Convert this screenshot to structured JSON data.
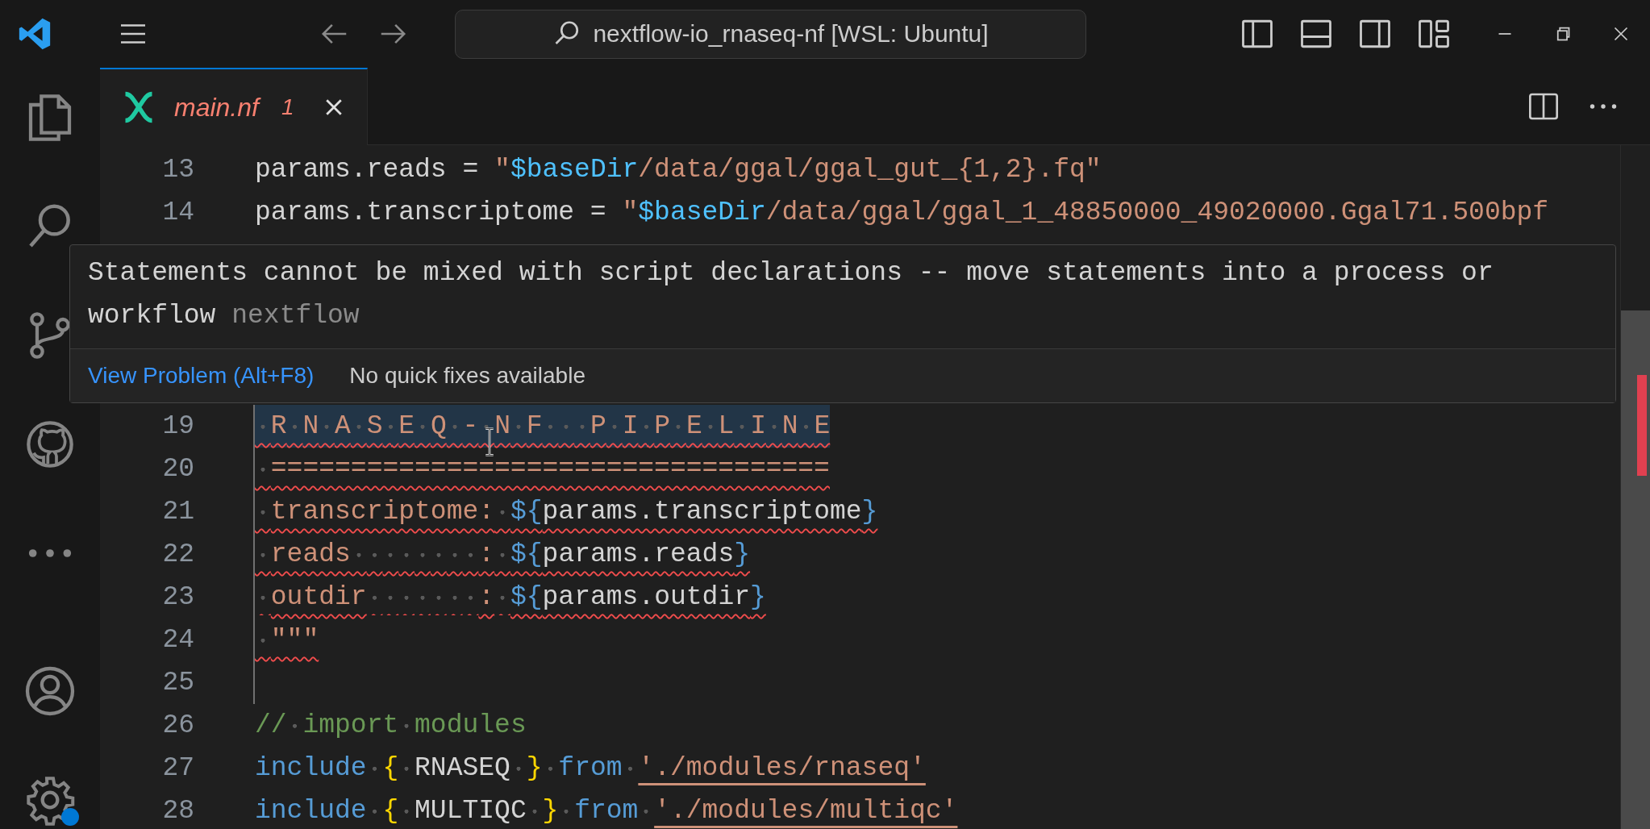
{
  "title_bar": {
    "search": "nextflow-io_rnaseq-nf [WSL: Ubuntu]"
  },
  "activity_bar": {
    "items": [
      {
        "kind": "files"
      },
      {
        "kind": "search"
      },
      {
        "kind": "source-control"
      },
      {
        "kind": "github"
      },
      {
        "kind": "more"
      },
      {
        "kind": "account"
      },
      {
        "kind": "settings",
        "badge": true
      }
    ]
  },
  "tabs": [
    {
      "label": "main.nf",
      "problems": "1",
      "selected": true,
      "has_errors": true
    }
  ],
  "editor": {
    "lines": [
      {
        "number": "13",
        "error": false,
        "selected": false,
        "whitespace": false,
        "guide": false,
        "tokens": [
          {
            "kind": "plain",
            "text": "params.reads = "
          },
          {
            "kind": "string",
            "text": "\""
          },
          {
            "kind": "var",
            "text": "$baseDir"
          },
          {
            "kind": "string",
            "text": "/data/ggal/ggal_gut_{1,2}.fq\""
          }
        ]
      },
      {
        "number": "14",
        "error": false,
        "selected": false,
        "whitespace": false,
        "guide": false,
        "tokens": [
          {
            "kind": "plain",
            "text": "params.transcriptome = "
          },
          {
            "kind": "string",
            "text": "\""
          },
          {
            "kind": "var",
            "text": "$baseDir"
          },
          {
            "kind": "string",
            "text": "/data/ggal/ggal_1_48850000_49020000.Ggal71.500bpf"
          }
        ]
      },
      {
        "number": "19",
        "error": true,
        "selected": true,
        "whitespace": true,
        "guide": true,
        "tokens": [
          {
            "kind": "string",
            "text": " R N A S E Q - N F   P I P E L I N E"
          }
        ]
      },
      {
        "number": "20",
        "error": true,
        "selected": false,
        "whitespace": true,
        "guide": true,
        "tokens": [
          {
            "kind": "string",
            "text": " ==================================="
          }
        ]
      },
      {
        "number": "21",
        "error": true,
        "selected": false,
        "whitespace": true,
        "guide": true,
        "tokens": [
          {
            "kind": "string",
            "text": " transcriptome: "
          },
          {
            "kind": "interp",
            "text": "${"
          },
          {
            "kind": "plain",
            "text": "params.transcriptome"
          },
          {
            "kind": "interp",
            "text": "}"
          }
        ]
      },
      {
        "number": "22",
        "error": true,
        "selected": false,
        "whitespace": true,
        "guide": true,
        "tokens": [
          {
            "kind": "string",
            "text": " reads        : "
          },
          {
            "kind": "interp",
            "text": "${"
          },
          {
            "kind": "plain",
            "text": "params.reads"
          },
          {
            "kind": "interp",
            "text": "}"
          }
        ]
      },
      {
        "number": "23",
        "error": true,
        "selected": false,
        "whitespace": true,
        "guide": true,
        "tokens": [
          {
            "kind": "string",
            "text": " outdir       : "
          },
          {
            "kind": "interp",
            "text": "${"
          },
          {
            "kind": "plain",
            "text": "params.outdir"
          },
          {
            "kind": "interp",
            "text": "}"
          }
        ]
      },
      {
        "number": "24",
        "error": true,
        "selected": false,
        "whitespace": true,
        "guide": true,
        "tokens": [
          {
            "kind": "string",
            "text": " \"\"\""
          }
        ]
      },
      {
        "number": "25",
        "error": false,
        "selected": false,
        "guide": true
      },
      {
        "number": "26",
        "error": false,
        "selected": false,
        "whitespace": true,
        "guide": false,
        "tokens": [
          {
            "kind": "comment",
            "text": "// import modules"
          }
        ]
      },
      {
        "number": "27",
        "error": false,
        "selected": false,
        "whitespace": true,
        "guide": false,
        "tokens": [
          {
            "kind": "keyword",
            "text": "include"
          },
          {
            "kind": "brace",
            "text": " {"
          },
          {
            "kind": "plain",
            "text": " RNASEQ "
          },
          {
            "kind": "brace",
            "text": "}"
          },
          {
            "kind": "keyword",
            "text": " from "
          },
          {
            "kind": "link",
            "text": "'./modules/rnaseq'"
          }
        ]
      },
      {
        "number": "28",
        "error": false,
        "selected": false,
        "whitespace": true,
        "guide": false,
        "tokens": [
          {
            "kind": "keyword",
            "text": "include"
          },
          {
            "kind": "brace",
            "text": " {"
          },
          {
            "kind": "plain",
            "text": " MULTIQC "
          },
          {
            "kind": "brace",
            "text": "}"
          },
          {
            "kind": "keyword",
            "text": " from "
          },
          {
            "kind": "link",
            "text": "'./modules/multiqc'"
          }
        ]
      }
    ]
  },
  "hover": {
    "message": "Statements cannot be mixed with script declarations -- move statements into a process or workflow",
    "source": "nextflow",
    "action": "View Problem (Alt+F8)",
    "note": "No quick fixes available"
  }
}
